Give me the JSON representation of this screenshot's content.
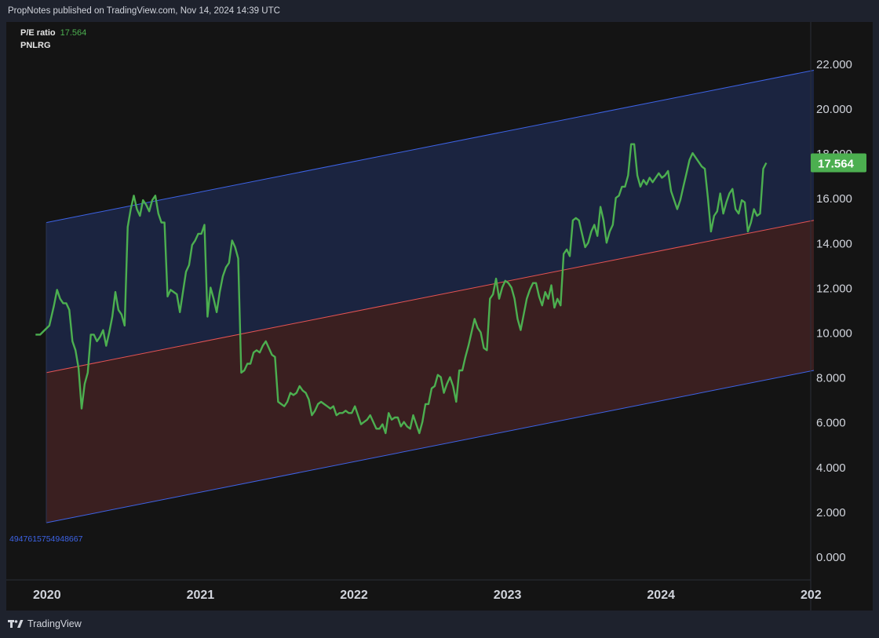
{
  "header": {
    "published_text": "PropNotes published on TradingView.com, Nov 14, 2024 14:39 UTC"
  },
  "legend": {
    "indicator_name": "P/E ratio",
    "indicator_value": "17.564",
    "symbol": "PNLRG"
  },
  "channel_label": "4947615754948667",
  "footer": {
    "brand": "TradingView"
  },
  "colors": {
    "line": "#4caf50",
    "upper_band_fill": "#1b2440",
    "lower_band_fill": "#3a1f20",
    "channel_edge": "#3d63e6",
    "midline": "#e55353",
    "badge": "#4caf50"
  },
  "chart_data": {
    "type": "line",
    "title": "",
    "xlabel": "",
    "ylabel": "",
    "ylim": [
      -0.5,
      24.0
    ],
    "yticks": [
      "22.000",
      "20.000",
      "18.000",
      "16.000",
      "14.000",
      "12.000",
      "10.000",
      "8.000",
      "6.000",
      "4.000",
      "2.000",
      "0.000"
    ],
    "xticks": [
      {
        "label": "2020",
        "year": 2020.0
      },
      {
        "label": "2021",
        "year": 2021.0
      },
      {
        "label": "2022",
        "year": 2022.0
      },
      {
        "label": "2023",
        "year": 2023.0
      },
      {
        "label": "2024",
        "year": 2024.0
      },
      {
        "label": "202",
        "year": 2025.0
      }
    ],
    "last_value_label": "17.564",
    "series": [
      {
        "points": [
          [
            2019.93,
            9.9
          ],
          [
            2019.96,
            9.9
          ],
          [
            2019.99,
            10.1
          ],
          [
            2020.02,
            10.3
          ],
          [
            2020.05,
            11.2
          ],
          [
            2020.07,
            11.9
          ],
          [
            2020.09,
            11.5
          ],
          [
            2020.11,
            11.3
          ],
          [
            2020.13,
            11.3
          ],
          [
            2020.15,
            11.0
          ],
          [
            2020.17,
            9.6
          ],
          [
            2020.19,
            9.2
          ],
          [
            2020.21,
            8.4
          ],
          [
            2020.23,
            6.6
          ],
          [
            2020.25,
            7.7
          ],
          [
            2020.27,
            8.2
          ],
          [
            2020.29,
            9.9
          ],
          [
            2020.31,
            9.9
          ],
          [
            2020.33,
            9.6
          ],
          [
            2020.35,
            9.8
          ],
          [
            2020.37,
            10.1
          ],
          [
            2020.39,
            9.4
          ],
          [
            2020.41,
            10.0
          ],
          [
            2020.43,
            10.7
          ],
          [
            2020.45,
            11.8
          ],
          [
            2020.47,
            11.0
          ],
          [
            2020.49,
            10.8
          ],
          [
            2020.51,
            10.3
          ],
          [
            2020.53,
            14.7
          ],
          [
            2020.55,
            15.5
          ],
          [
            2020.57,
            16.1
          ],
          [
            2020.59,
            15.5
          ],
          [
            2020.61,
            15.2
          ],
          [
            2020.63,
            15.9
          ],
          [
            2020.65,
            15.7
          ],
          [
            2020.67,
            15.4
          ],
          [
            2020.69,
            15.9
          ],
          [
            2020.71,
            16.1
          ],
          [
            2020.73,
            15.3
          ],
          [
            2020.75,
            14.9
          ],
          [
            2020.77,
            14.9
          ],
          [
            2020.79,
            11.6
          ],
          [
            2020.81,
            11.9
          ],
          [
            2020.83,
            11.8
          ],
          [
            2020.85,
            11.7
          ],
          [
            2020.87,
            10.9
          ],
          [
            2020.89,
            11.8
          ],
          [
            2020.91,
            12.7
          ],
          [
            2020.93,
            13.0
          ],
          [
            2020.95,
            13.9
          ],
          [
            2020.97,
            14.1
          ],
          [
            2020.99,
            14.4
          ],
          [
            2021.01,
            14.4
          ],
          [
            2021.03,
            14.8
          ],
          [
            2021.05,
            10.7
          ],
          [
            2021.07,
            12.0
          ],
          [
            2021.09,
            11.5
          ],
          [
            2021.11,
            10.9
          ],
          [
            2021.13,
            11.8
          ],
          [
            2021.15,
            12.5
          ],
          [
            2021.17,
            12.9
          ],
          [
            2021.19,
            13.1
          ],
          [
            2021.21,
            14.1
          ],
          [
            2021.23,
            13.8
          ],
          [
            2021.25,
            13.3
          ],
          [
            2021.27,
            8.2
          ],
          [
            2021.29,
            8.3
          ],
          [
            2021.31,
            8.6
          ],
          [
            2021.33,
            8.6
          ],
          [
            2021.35,
            9.1
          ],
          [
            2021.37,
            9.2
          ],
          [
            2021.39,
            9.1
          ],
          [
            2021.41,
            9.4
          ],
          [
            2021.43,
            9.6
          ],
          [
            2021.45,
            9.3
          ],
          [
            2021.47,
            9.0
          ],
          [
            2021.49,
            8.9
          ],
          [
            2021.51,
            6.9
          ],
          [
            2021.53,
            6.8
          ],
          [
            2021.55,
            6.7
          ],
          [
            2021.57,
            6.9
          ],
          [
            2021.59,
            7.3
          ],
          [
            2021.61,
            7.2
          ],
          [
            2021.63,
            7.3
          ],
          [
            2021.65,
            7.6
          ],
          [
            2021.67,
            7.4
          ],
          [
            2021.69,
            7.3
          ],
          [
            2021.71,
            7.0
          ],
          [
            2021.73,
            6.3
          ],
          [
            2021.75,
            6.5
          ],
          [
            2021.77,
            6.8
          ],
          [
            2021.79,
            6.9
          ],
          [
            2021.81,
            6.8
          ],
          [
            2021.83,
            6.7
          ],
          [
            2021.85,
            6.6
          ],
          [
            2021.87,
            6.7
          ],
          [
            2021.89,
            6.3
          ],
          [
            2021.91,
            6.4
          ],
          [
            2021.93,
            6.4
          ],
          [
            2021.95,
            6.5
          ],
          [
            2021.97,
            6.4
          ],
          [
            2021.99,
            6.4
          ],
          [
            2022.01,
            6.7
          ],
          [
            2022.03,
            6.3
          ],
          [
            2022.05,
            5.9
          ],
          [
            2022.07,
            6.0
          ],
          [
            2022.09,
            6.1
          ],
          [
            2022.11,
            6.3
          ],
          [
            2022.13,
            6.0
          ],
          [
            2022.15,
            5.7
          ],
          [
            2022.17,
            5.7
          ],
          [
            2022.19,
            5.9
          ],
          [
            2022.21,
            5.5
          ],
          [
            2022.23,
            6.4
          ],
          [
            2022.25,
            6.1
          ],
          [
            2022.27,
            6.2
          ],
          [
            2022.29,
            6.2
          ],
          [
            2022.31,
            5.8
          ],
          [
            2022.33,
            6.0
          ],
          [
            2022.35,
            5.8
          ],
          [
            2022.37,
            5.7
          ],
          [
            2022.39,
            6.3
          ],
          [
            2022.41,
            5.9
          ],
          [
            2022.43,
            5.5
          ],
          [
            2022.45,
            6.0
          ],
          [
            2022.47,
            6.8
          ],
          [
            2022.49,
            6.8
          ],
          [
            2022.51,
            7.5
          ],
          [
            2022.53,
            7.6
          ],
          [
            2022.55,
            8.1
          ],
          [
            2022.57,
            8.0
          ],
          [
            2022.59,
            7.3
          ],
          [
            2022.61,
            7.7
          ],
          [
            2022.63,
            8.0
          ],
          [
            2022.65,
            7.6
          ],
          [
            2022.67,
            6.9
          ],
          [
            2022.69,
            8.3
          ],
          [
            2022.71,
            8.3
          ],
          [
            2022.73,
            8.9
          ],
          [
            2022.75,
            9.4
          ],
          [
            2022.77,
            10.0
          ],
          [
            2022.79,
            10.6
          ],
          [
            2022.81,
            10.2
          ],
          [
            2022.83,
            10.0
          ],
          [
            2022.85,
            9.3
          ],
          [
            2022.87,
            9.2
          ],
          [
            2022.89,
            11.5
          ],
          [
            2022.91,
            11.7
          ],
          [
            2022.93,
            12.4
          ],
          [
            2022.95,
            11.5
          ],
          [
            2022.97,
            12.0
          ],
          [
            2022.99,
            12.3
          ],
          [
            2023.01,
            12.2
          ],
          [
            2023.03,
            12.0
          ],
          [
            2023.05,
            11.5
          ],
          [
            2023.07,
            10.6
          ],
          [
            2023.09,
            10.1
          ],
          [
            2023.11,
            10.8
          ],
          [
            2023.13,
            11.5
          ],
          [
            2023.15,
            11.9
          ],
          [
            2023.17,
            12.2
          ],
          [
            2023.19,
            12.2
          ],
          [
            2023.21,
            11.6
          ],
          [
            2023.23,
            11.2
          ],
          [
            2023.25,
            11.8
          ],
          [
            2023.27,
            11.5
          ],
          [
            2023.29,
            12.1
          ],
          [
            2023.31,
            11.1
          ],
          [
            2023.33,
            11.5
          ],
          [
            2023.35,
            11.2
          ],
          [
            2023.37,
            13.5
          ],
          [
            2023.39,
            13.7
          ],
          [
            2023.41,
            13.4
          ],
          [
            2023.43,
            15.0
          ],
          [
            2023.45,
            15.1
          ],
          [
            2023.47,
            15.0
          ],
          [
            2023.49,
            14.4
          ],
          [
            2023.51,
            13.8
          ],
          [
            2023.53,
            14.0
          ],
          [
            2023.55,
            14.5
          ],
          [
            2023.57,
            14.8
          ],
          [
            2023.59,
            14.3
          ],
          [
            2023.61,
            15.6
          ],
          [
            2023.63,
            15.0
          ],
          [
            2023.65,
            14.0
          ],
          [
            2023.67,
            14.5
          ],
          [
            2023.69,
            14.8
          ],
          [
            2023.71,
            16.0
          ],
          [
            2023.73,
            16.1
          ],
          [
            2023.75,
            16.5
          ],
          [
            2023.77,
            16.5
          ],
          [
            2023.79,
            17.0
          ],
          [
            2023.81,
            18.4
          ],
          [
            2023.83,
            18.4
          ],
          [
            2023.85,
            17.0
          ],
          [
            2023.87,
            16.5
          ],
          [
            2023.89,
            16.8
          ],
          [
            2023.91,
            16.6
          ],
          [
            2023.93,
            16.9
          ],
          [
            2023.95,
            16.7
          ],
          [
            2023.97,
            16.9
          ],
          [
            2023.99,
            17.1
          ],
          [
            2024.01,
            16.9
          ],
          [
            2024.03,
            17.0
          ],
          [
            2024.05,
            17.2
          ],
          [
            2024.07,
            16.3
          ],
          [
            2024.09,
            15.9
          ],
          [
            2024.11,
            15.5
          ],
          [
            2024.13,
            15.9
          ],
          [
            2024.15,
            16.5
          ],
          [
            2024.17,
            17.1
          ],
          [
            2024.19,
            17.7
          ],
          [
            2024.21,
            18.0
          ],
          [
            2024.23,
            17.8
          ],
          [
            2024.25,
            17.6
          ],
          [
            2024.27,
            17.4
          ],
          [
            2024.29,
            17.3
          ],
          [
            2024.31,
            16.0
          ],
          [
            2024.33,
            14.5
          ],
          [
            2024.35,
            15.2
          ],
          [
            2024.37,
            15.4
          ],
          [
            2024.39,
            16.2
          ],
          [
            2024.41,
            15.3
          ],
          [
            2024.43,
            15.8
          ],
          [
            2024.45,
            16.2
          ],
          [
            2024.47,
            16.4
          ],
          [
            2024.49,
            15.5
          ],
          [
            2024.51,
            15.3
          ],
          [
            2024.53,
            15.9
          ],
          [
            2024.55,
            15.8
          ],
          [
            2024.57,
            14.5
          ],
          [
            2024.59,
            14.9
          ],
          [
            2024.61,
            15.5
          ],
          [
            2024.63,
            15.2
          ],
          [
            2024.65,
            15.3
          ],
          [
            2024.67,
            17.3
          ],
          [
            2024.69,
            17.564
          ]
        ]
      }
    ],
    "channel": {
      "x_start": 2020.0,
      "x_end": 2025.0,
      "upper": [
        14.9,
        21.7
      ],
      "middle": [
        8.2,
        15.0
      ],
      "lower": [
        1.5,
        8.3
      ]
    }
  }
}
